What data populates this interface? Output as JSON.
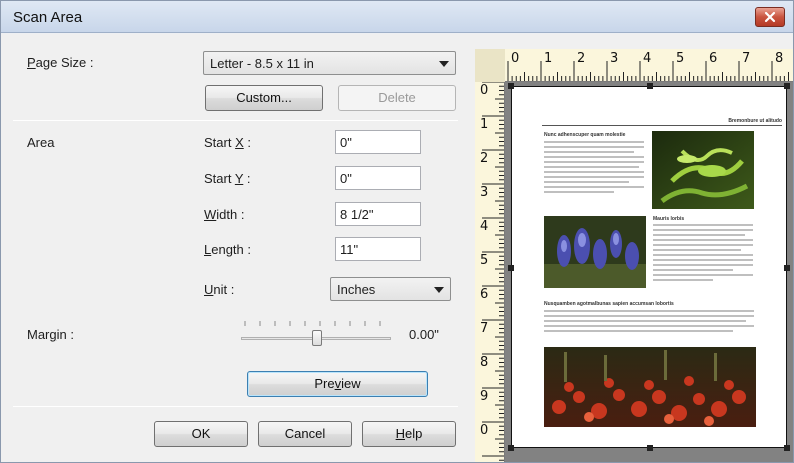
{
  "window": {
    "title": "Scan Area"
  },
  "page_size": {
    "label_pre": "",
    "label_u": "P",
    "label_post": "age Size :",
    "value": "Letter - 8.5 x 11 in"
  },
  "buttons": {
    "custom": "Custom...",
    "delete": "Delete",
    "preview_pre": "Pre",
    "preview_u": "v",
    "preview_post": "iew",
    "ok": "OK",
    "cancel": "Cancel",
    "help_u": "H",
    "help_post": "elp"
  },
  "area": {
    "label": "Area",
    "start_x": {
      "label_pre": "Start ",
      "label_u": "X",
      "label_post": " :",
      "value": "0\""
    },
    "start_y": {
      "label_pre": "Start ",
      "label_u": "Y",
      "label_post": " :",
      "value": "0\""
    },
    "width": {
      "label_u": "W",
      "label_post": "idth :",
      "value": "8 1/2\""
    },
    "length": {
      "label_u": "L",
      "label_post": "ength :",
      "value": "11\""
    },
    "unit": {
      "label_u": "U",
      "label_post": "nit :",
      "value": "Inches"
    }
  },
  "margin": {
    "label_pre": "Mar",
    "label_u": "g",
    "label_post": "in :",
    "value": "0.00\"",
    "slider_fraction": 0.5
  },
  "ruler": {
    "horizontal": [
      "0",
      "1",
      "2",
      "3",
      "4",
      "5",
      "6",
      "7",
      "8"
    ],
    "vertical": [
      "0",
      "1",
      "2",
      "3",
      "4",
      "5",
      "6",
      "7",
      "8",
      "9",
      "0"
    ]
  },
  "preview_doc": {
    "header": "Bremonbure ut alitudo",
    "heading1": "Nunc adhenscuper quam molestie",
    "heading2": "Mauris lorbis",
    "heading3": "Nusquamben agotmalbunas sapien accumsan lobortis"
  },
  "icons": {
    "close": "close-icon",
    "dropdown": "chevron-down-icon"
  }
}
